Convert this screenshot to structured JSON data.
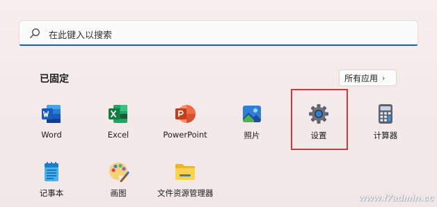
{
  "search": {
    "placeholder": "在此键入以搜索",
    "icon": "search-icon"
  },
  "pinned": {
    "title": "已固定",
    "all_apps_label": "所有应用",
    "all_apps_icon": "chevron-right-icon",
    "apps": [
      {
        "label": "Word",
        "icon": "word-icon"
      },
      {
        "label": "Excel",
        "icon": "excel-icon"
      },
      {
        "label": "PowerPoint",
        "icon": "powerpoint-icon"
      },
      {
        "label": "照片",
        "icon": "photos-icon"
      },
      {
        "label": "设置",
        "icon": "settings-gear-icon",
        "highlighted": true
      },
      {
        "label": "计算器",
        "icon": "calculator-icon"
      },
      {
        "label": "记事本",
        "icon": "notepad-icon"
      },
      {
        "label": "画图",
        "icon": "paint-icon"
      },
      {
        "label": "文件资源管理器",
        "icon": "file-explorer-icon"
      }
    ]
  },
  "colors": {
    "highlight_border": "#d8343a",
    "search_accent": "#1f5e8f"
  },
  "watermark": "www.f7admin.cc"
}
